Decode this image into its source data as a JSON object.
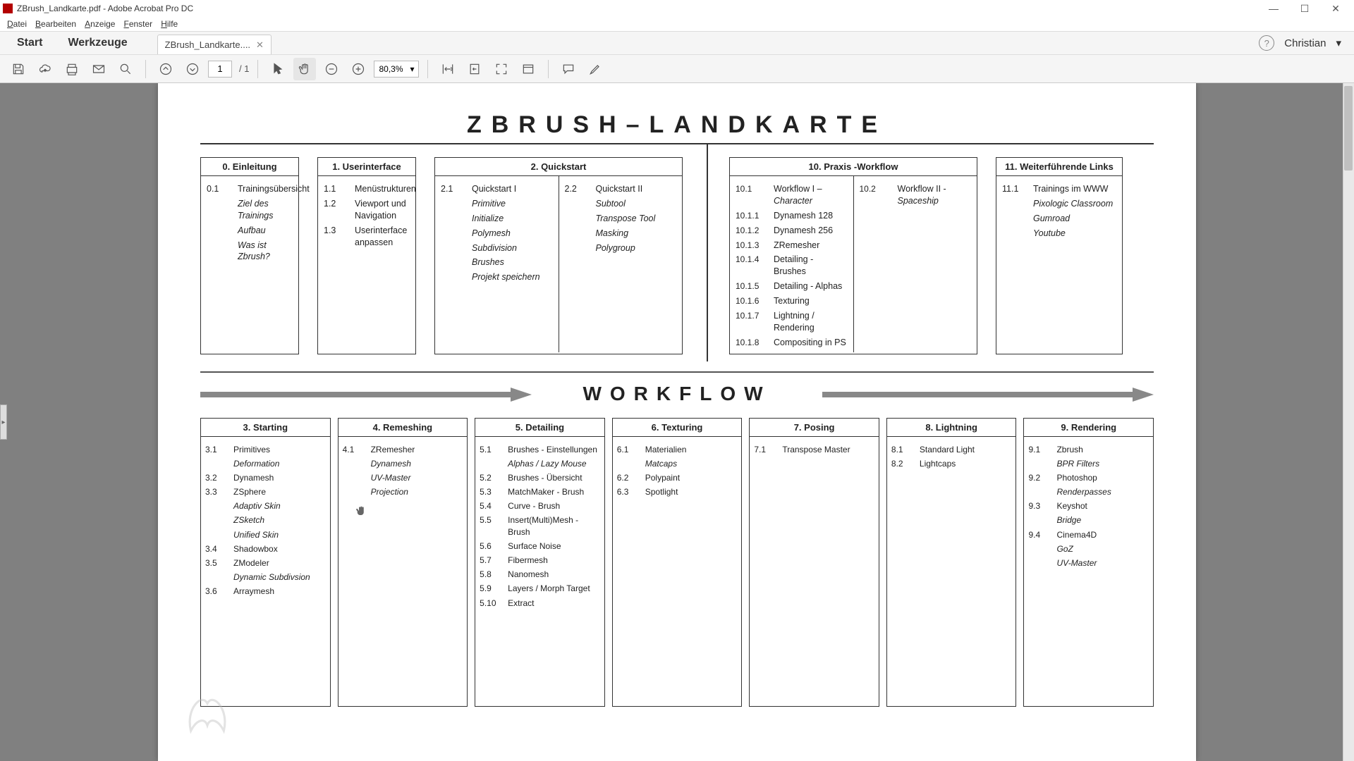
{
  "window": {
    "title": "ZBrush_Landkarte.pdf - Adobe Acrobat Pro DC"
  },
  "menubar": [
    "Datei",
    "Bearbeiten",
    "Anzeige",
    "Fenster",
    "Hilfe"
  ],
  "tabs": {
    "start": "Start",
    "tools": "Werkzeuge",
    "doc": "ZBrush_Landkarte....",
    "user": "Christian"
  },
  "toolbar": {
    "page_current": "1",
    "page_total": "/ 1",
    "zoom": "80,3%"
  },
  "doc": {
    "title": "ZBRUSH–LANDKARTE",
    "workflowTitle": "WORKFLOW",
    "top": [
      {
        "title": "0. Einleitung",
        "rows": [
          {
            "n": "0.1",
            "t": "Trainingsübersicht"
          },
          {
            "n": "",
            "t": "Ziel des Trainings",
            "i": true
          },
          {
            "n": "",
            "t": "Aufbau",
            "i": true
          },
          {
            "n": "",
            "t": "Was ist Zbrush?",
            "i": true
          }
        ]
      },
      {
        "title": "1. Userinterface",
        "rows": [
          {
            "n": "1.1",
            "t": "Menüstrukturen"
          },
          {
            "n": "1.2",
            "t": "Viewport und Navigation"
          },
          {
            "n": "1.3",
            "t": "Userinterface anpassen"
          }
        ]
      },
      {
        "title": "2. Quickstart",
        "cols": [
          {
            "h": {
              "n": "2.1",
              "t": "Quickstart I"
            },
            "rows": [
              {
                "t": "Primitive",
                "i": true
              },
              {
                "t": "Initialize",
                "i": true
              },
              {
                "t": "Polymesh",
                "i": true
              },
              {
                "t": "Subdivision",
                "i": true
              },
              {
                "t": "Brushes",
                "i": true
              },
              {
                "t": "Projekt speichern",
                "i": true
              }
            ]
          },
          {
            "h": {
              "n": "2.2",
              "t": "Quickstart II"
            },
            "rows": [
              {
                "t": "Subtool",
                "i": true
              },
              {
                "t": "Transpose Tool",
                "i": true
              },
              {
                "t": "Masking",
                "i": true
              },
              {
                "t": "Polygroup",
                "i": true
              }
            ]
          }
        ]
      },
      {
        "title": "10. Praxis -Workflow",
        "cols": [
          {
            "h": {
              "n": "10.1",
              "t": "Workflow I – ",
              "it": "Character"
            },
            "rows": [
              {
                "n": "10.1.1",
                "t": "Dynamesh 128"
              },
              {
                "n": "10.1.2",
                "t": "Dynamesh 256"
              },
              {
                "n": "10.1.3",
                "t": "ZRemesher"
              },
              {
                "n": "10.1.4",
                "t": "Detailing - Brushes"
              },
              {
                "n": "10.1.5",
                "t": "Detailing - Alphas"
              },
              {
                "n": "10.1.6",
                "t": "Texturing"
              },
              {
                "n": "10.1.7",
                "t": "Lightning / Rendering"
              },
              {
                "n": "10.1.8",
                "t": "Compositing in PS"
              }
            ]
          },
          {
            "h": {
              "n": "10.2",
              "t": "Workflow II - ",
              "it": "Spaceship"
            },
            "rows": []
          }
        ]
      },
      {
        "title": "11. Weiterführende Links",
        "rows": [
          {
            "n": "11.1",
            "t": "Trainings im WWW"
          },
          {
            "n": "",
            "t": "Pixologic Classroom",
            "i": true
          },
          {
            "n": "",
            "t": "Gumroad",
            "i": true
          },
          {
            "n": "",
            "t": "Youtube",
            "i": true
          }
        ]
      }
    ],
    "wf": [
      {
        "title": "3. Starting",
        "rows": [
          {
            "n": "3.1",
            "t": "Primitives"
          },
          {
            "n": "",
            "t": "Deformation",
            "i": true
          },
          {
            "n": "3.2",
            "t": "Dynamesh"
          },
          {
            "n": "3.3",
            "t": "ZSphere"
          },
          {
            "n": "",
            "t": "Adaptiv Skin",
            "i": true
          },
          {
            "n": "",
            "t": "ZSketch",
            "i": true
          },
          {
            "n": "",
            "t": "Unified Skin",
            "i": true
          },
          {
            "n": "3.4",
            "t": "Shadowbox"
          },
          {
            "n": "3.5",
            "t": "ZModeler"
          },
          {
            "n": "",
            "t": "Dynamic Subdivsion",
            "i": true
          },
          {
            "n": "3.6",
            "t": "Arraymesh"
          }
        ]
      },
      {
        "title": "4. Remeshing",
        "rows": [
          {
            "n": "4.1",
            "t": "ZRemesher"
          },
          {
            "n": "",
            "t": "Dynamesh",
            "i": true
          },
          {
            "n": "",
            "t": "UV-Master",
            "i": true
          },
          {
            "n": "",
            "t": "Projection",
            "i": true
          }
        ]
      },
      {
        "title": "5. Detailing",
        "rows": [
          {
            "n": "5.1",
            "t": "Brushes - Einstellungen"
          },
          {
            "n": "",
            "t": "Alphas / Lazy Mouse",
            "i": true
          },
          {
            "n": "5.2",
            "t": "Brushes - Übersicht"
          },
          {
            "n": "5.3",
            "t": "MatchMaker - Brush"
          },
          {
            "n": "5.4",
            "t": "Curve - Brush"
          },
          {
            "n": "5.5",
            "t": "Insert(Multi)Mesh - Brush"
          },
          {
            "n": "5.6",
            "t": "Surface Noise"
          },
          {
            "n": "5.7",
            "t": "Fibermesh"
          },
          {
            "n": "5.8",
            "t": "Nanomesh"
          },
          {
            "n": "5.9",
            "t": "Layers / Morph Target"
          },
          {
            "n": "5.10",
            "t": "Extract"
          }
        ]
      },
      {
        "title": "6. Texturing",
        "rows": [
          {
            "n": "6.1",
            "t": "Materialien"
          },
          {
            "n": "",
            "t": "Matcaps",
            "i": true
          },
          {
            "n": "6.2",
            "t": "Polypaint"
          },
          {
            "n": "6.3",
            "t": "Spotlight"
          }
        ]
      },
      {
        "title": "7. Posing",
        "rows": [
          {
            "n": "7.1",
            "t": "Transpose Master"
          }
        ]
      },
      {
        "title": "8. Lightning",
        "rows": [
          {
            "n": "8.1",
            "t": "Standard Light"
          },
          {
            "n": "8.2",
            "t": "Lightcaps"
          }
        ]
      },
      {
        "title": "9. Rendering",
        "rows": [
          {
            "n": "9.1",
            "t": "Zbrush"
          },
          {
            "n": "",
            "t": "BPR Filters",
            "i": true
          },
          {
            "n": "9.2",
            "t": "Photoshop"
          },
          {
            "n": "",
            "t": "Renderpasses",
            "i": true
          },
          {
            "n": "9.3",
            "t": "Keyshot"
          },
          {
            "n": "",
            "t": "Bridge",
            "i": true
          },
          {
            "n": "9.4",
            "t": "Cinema4D"
          },
          {
            "n": "",
            "t": "GoZ",
            "i": true
          },
          {
            "n": "",
            "t": "UV-Master",
            "i": true
          }
        ]
      }
    ]
  }
}
